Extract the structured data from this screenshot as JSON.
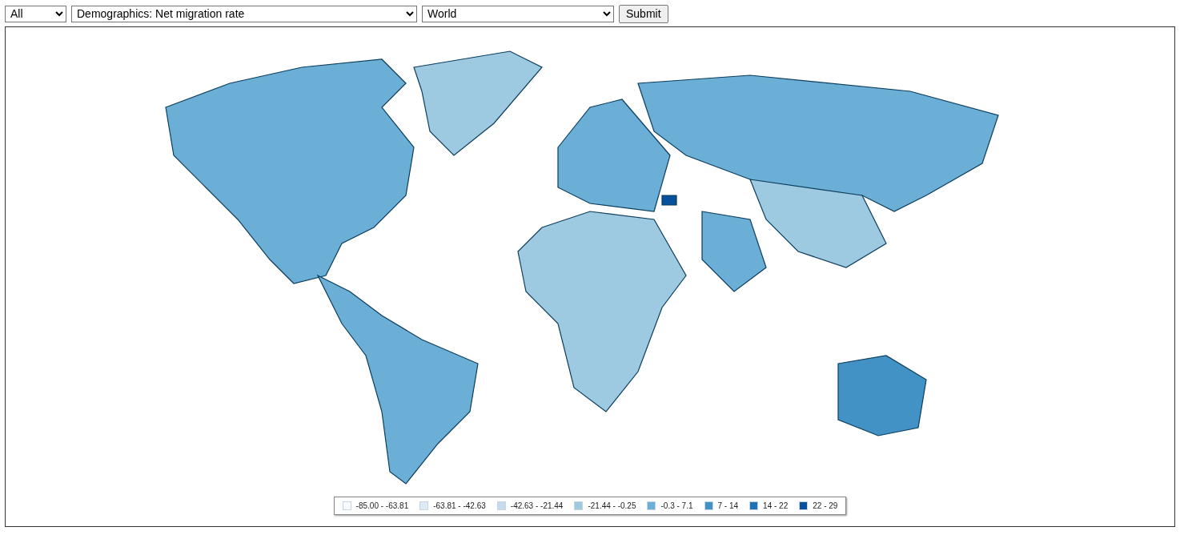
{
  "controls": {
    "category": "All",
    "indicator": "Demographics: Net migration rate",
    "region": "World",
    "submit": "Submit"
  },
  "legend": [
    {
      "label": "-85.00 - -63.81",
      "color": "#f7fbff"
    },
    {
      "label": "-63.81 - -42.63",
      "color": "#deebf7"
    },
    {
      "label": "-42.63 - -21.44",
      "color": "#c6dbef"
    },
    {
      "label": "-21.44 - -0.25",
      "color": "#9ecae1"
    },
    {
      "label": "-0.3 - 7.1",
      "color": "#6baed6"
    },
    {
      "label": "7 - 14",
      "color": "#4292c6"
    },
    {
      "label": "14 - 22",
      "color": "#2171b5"
    },
    {
      "label": "22 - 29",
      "color": "#08519c"
    }
  ]
}
